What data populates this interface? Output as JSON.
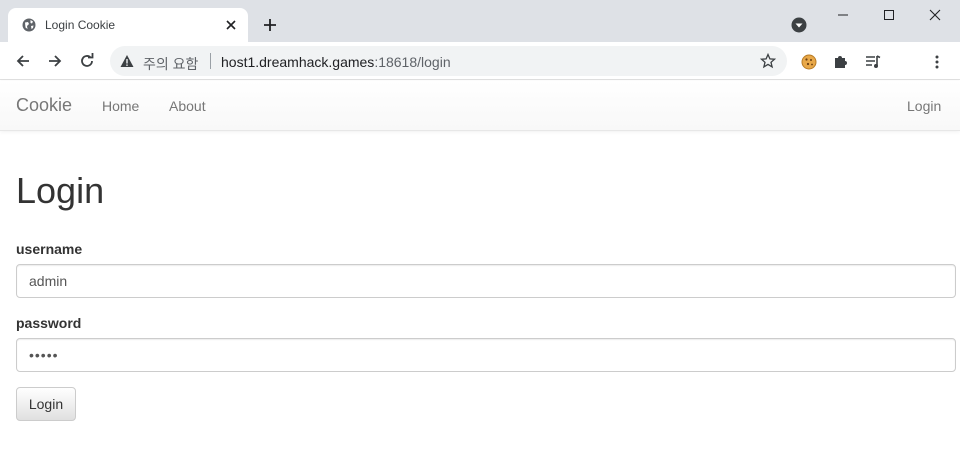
{
  "browser": {
    "tab": {
      "title": "Login Cookie"
    },
    "address_bar": {
      "security_label": "주의 요함",
      "url_host": "host1.dreamhack.games",
      "url_rest": ":18618/login"
    }
  },
  "navbar": {
    "brand": "Cookie",
    "links": [
      "Home",
      "About"
    ],
    "right_link": "Login"
  },
  "main": {
    "title": "Login",
    "username_label": "username",
    "username_value": "admin",
    "password_label": "password",
    "password_value": "admin",
    "submit_label": "Login"
  },
  "colors": {
    "chrome_bg": "#dee1e6",
    "omnibox_bg": "#f1f3f4",
    "navbar_text": "#777777",
    "heading_text": "#333333"
  },
  "icons": [
    "globe-icon",
    "close-icon",
    "plus-icon",
    "profile-icon",
    "back-icon",
    "forward-icon",
    "reload-icon",
    "warning-icon",
    "star-icon",
    "cookie-icon",
    "puzzle-icon",
    "media-icon",
    "menu-icon"
  ]
}
